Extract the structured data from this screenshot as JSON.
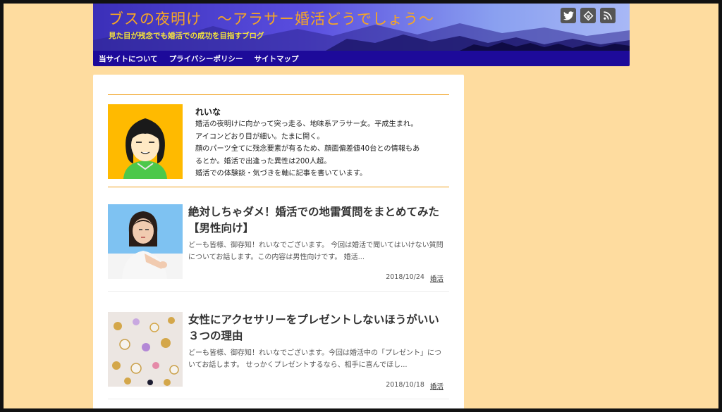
{
  "header": {
    "title": "ブスの夜明け　〜アラサー婚活どうでしょう〜",
    "subtitle": "見た目が残念でも婚活での成功を目指すブログ",
    "social": [
      {
        "name": "twitter-icon"
      },
      {
        "name": "feedly-icon"
      },
      {
        "name": "rss-icon"
      }
    ]
  },
  "nav": {
    "items": [
      {
        "label": "当サイトについて"
      },
      {
        "label": "プライバシーポリシー"
      },
      {
        "label": "サイトマップ"
      }
    ]
  },
  "profile": {
    "name": "れいな",
    "bio": [
      "婚活の夜明けに向かって突っ走る、地味系アラサー女。平成生まれ。",
      "アイコンどおり目が細い。たまに開く。",
      "顔のパーツ全てに残念要素が有るため、顔面偏差値40台との情報もあ",
      "るとか。婚活で出逢った異性は200人超。",
      "婚活での体験談・気づきを軸に記事を書いています。"
    ]
  },
  "posts": [
    {
      "title": "絶対しちゃダメ！婚活での地雷質問をまとめてみた【男性向け】",
      "excerpt": "どーも皆様、御存知！れいなでございます。 今回は婚活で聞いてはいけない質問についてお話します。この内容は男性向けです。 婚活...",
      "date": "2018/10/24",
      "category": "婚活"
    },
    {
      "title": "女性にアクセサリーをプレゼントしないほうがいい３つの理由",
      "excerpt": "どーも皆様、御存知！れいなでございます。今回は婚活中の「プレゼント」についてお話します。 せっかくプレゼントするなら、相手に喜んでほし...",
      "date": "2018/10/18",
      "category": "婚活"
    }
  ],
  "colors": {
    "background": "#fedc9f",
    "nav": "#1d0a9a",
    "title": "#f7a623",
    "subtitle": "#f4e23c",
    "accent_line": "#f0a01c",
    "avatar_bg": "#ffba00"
  }
}
